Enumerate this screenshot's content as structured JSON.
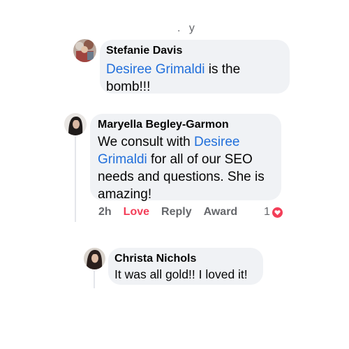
{
  "thread": {
    "top_fragment": ". y",
    "comments": [
      {
        "author": "Stefanie Davis",
        "mention": "Desiree Grimaldi",
        "text_after_mention": " is the bomb!!!"
      },
      {
        "author": "Maryella Begley-Garmon",
        "text_before_mention": "We consult with ",
        "mention": "Desiree Grimaldi",
        "text_after_mention": " for all of our SEO needs and questions. She is amazing!",
        "timestamp": "2h",
        "reaction_label": "Love",
        "reply_label": "Reply",
        "award_label": "Award",
        "reaction_count": "1",
        "reaction_icon": "heart-icon",
        "reaction_color": "#f33e58"
      },
      {
        "author": "Christa Nichols",
        "text": "It was all gold!! I loved it!"
      }
    ]
  },
  "colors": {
    "bubble": "#f0f2f5",
    "mention": "#216fdb",
    "meta": "#65676b",
    "love": "#f33e58"
  }
}
